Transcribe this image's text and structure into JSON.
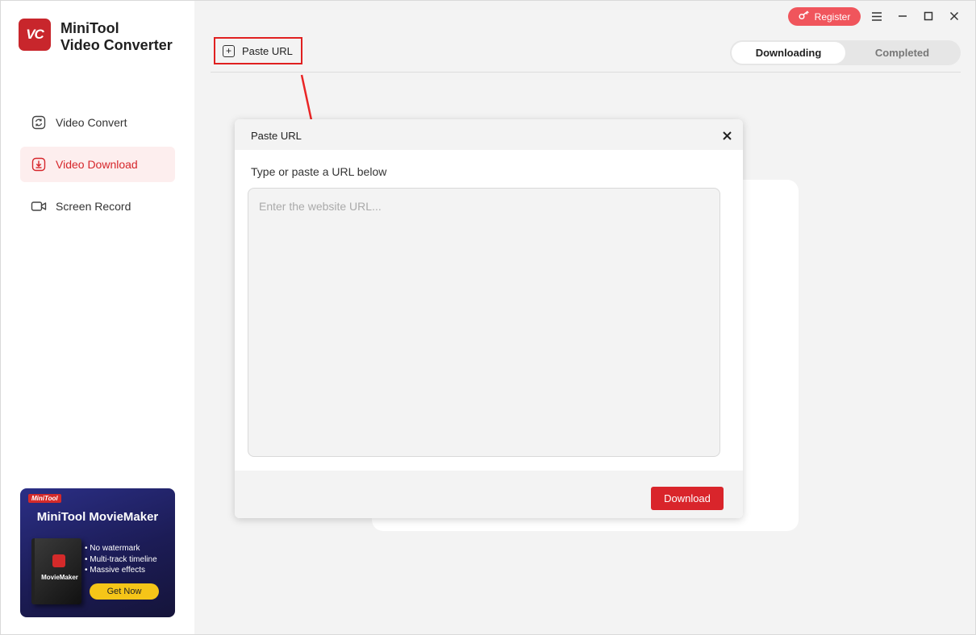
{
  "app": {
    "logo_text": "VC",
    "name": "MiniTool\nVideo Converter"
  },
  "sidebar": {
    "items": [
      {
        "label": "Video Convert",
        "icon": "refresh-icon",
        "active": false
      },
      {
        "label": "Video Download",
        "icon": "download-icon",
        "active": true
      },
      {
        "label": "Screen Record",
        "icon": "video-camera-icon",
        "active": false
      }
    ]
  },
  "promo": {
    "badge": "MiniTool",
    "title": "MiniTool MovieMaker",
    "product_box": "MovieMaker",
    "features": [
      "No watermark",
      "Multi-track timeline",
      "Massive effects"
    ],
    "cta": "Get Now"
  },
  "header": {
    "register_label": "Register",
    "paste_url_label": "Paste URL",
    "tabs": [
      {
        "label": "Downloading",
        "active": true
      },
      {
        "label": "Completed",
        "active": false
      }
    ]
  },
  "dialog": {
    "title": "Paste URL",
    "prompt": "Type or paste a URL below",
    "input_value": "",
    "input_placeholder": "Enter the website URL...",
    "download_label": "Download"
  },
  "colors": {
    "accent": "#d9252b",
    "register": "#f0555c",
    "active_nav_bg": "#fdeeee",
    "highlight_box": "#e02020"
  }
}
